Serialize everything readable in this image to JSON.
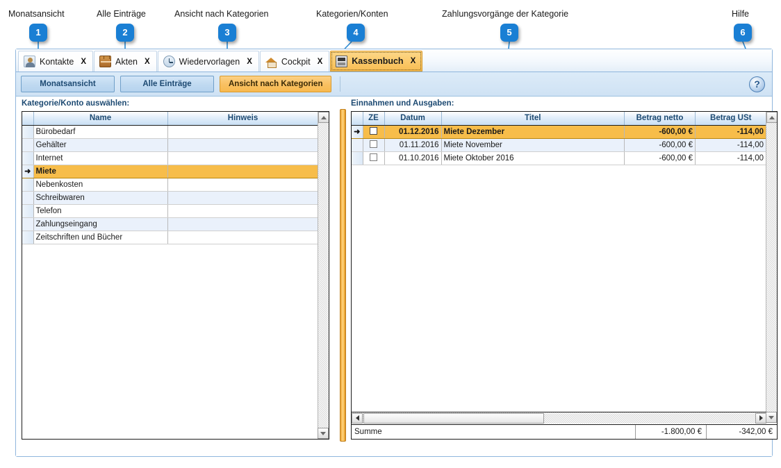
{
  "annotations": [
    {
      "n": "1",
      "label": "Monatsansicht"
    },
    {
      "n": "2",
      "label": "Alle Einträge"
    },
    {
      "n": "3",
      "label": "Ansicht nach Kategorien"
    },
    {
      "n": "4",
      "label": "Kategorien/Konten"
    },
    {
      "n": "5",
      "label": "Zahlungsvorgänge der Kategorie"
    },
    {
      "n": "6",
      "label": "Hilfe"
    }
  ],
  "tabs": [
    {
      "label": "Kontakte",
      "icon": "person-icon",
      "close": "X",
      "active": false
    },
    {
      "label": "Akten",
      "icon": "briefcase-icon",
      "close": "X",
      "active": false
    },
    {
      "label": "Wiedervorlagen",
      "icon": "clock-icon",
      "close": "X",
      "active": false
    },
    {
      "label": "Cockpit",
      "icon": "home-icon",
      "close": "X",
      "active": false
    },
    {
      "label": "Kassenbuch",
      "icon": "cashbook-icon",
      "close": "X",
      "active": true
    }
  ],
  "toolbar": {
    "buttons": [
      {
        "label": "Monatsansicht",
        "selected": false
      },
      {
        "label": "Alle Einträge",
        "selected": false
      },
      {
        "label": "Ansicht nach Kategorien",
        "selected": true
      }
    ],
    "help_glyph": "?"
  },
  "left_panel": {
    "caption": "Kategorie/Konto auswählen:",
    "columns": [
      "Name",
      "Hinweis"
    ],
    "rows": [
      {
        "name": "Bürobedarf",
        "hinweis": "",
        "selected": false
      },
      {
        "name": "Gehälter",
        "hinweis": "",
        "selected": false
      },
      {
        "name": "Internet",
        "hinweis": "",
        "selected": false
      },
      {
        "name": "Miete",
        "hinweis": "",
        "selected": true
      },
      {
        "name": "Nebenkosten",
        "hinweis": "",
        "selected": false
      },
      {
        "name": "Schreibwaren",
        "hinweis": "",
        "selected": false
      },
      {
        "name": "Telefon",
        "hinweis": "",
        "selected": false
      },
      {
        "name": "Zahlungseingang",
        "hinweis": "",
        "selected": false
      },
      {
        "name": "Zeitschriften und Bücher",
        "hinweis": "",
        "selected": false
      }
    ]
  },
  "right_panel": {
    "caption": "Einnahmen und Ausgaben:",
    "columns": [
      "ZE",
      "Datum",
      "Titel",
      "Betrag netto",
      "Betrag USt"
    ],
    "rows": [
      {
        "ze": false,
        "datum": "01.12.2016",
        "titel": "Miete Dezember",
        "netto": "-600,00 €",
        "ust": "-114,00",
        "selected": true
      },
      {
        "ze": false,
        "datum": "01.11.2016",
        "titel": "Miete November",
        "netto": "-600,00 €",
        "ust": "-114,00",
        "selected": false
      },
      {
        "ze": false,
        "datum": "01.10.2016",
        "titel": "Miete Oktober 2016",
        "netto": "-600,00 €",
        "ust": "-114,00",
        "selected": false
      }
    ],
    "summary": {
      "label": "Summe",
      "netto": "-1.800,00 €",
      "ust": "-342,00 €"
    }
  },
  "colors": {
    "accent_orange": "#f7bd4a",
    "badge_blue": "#1a7fd4",
    "header_blue": "#1d4a72"
  }
}
